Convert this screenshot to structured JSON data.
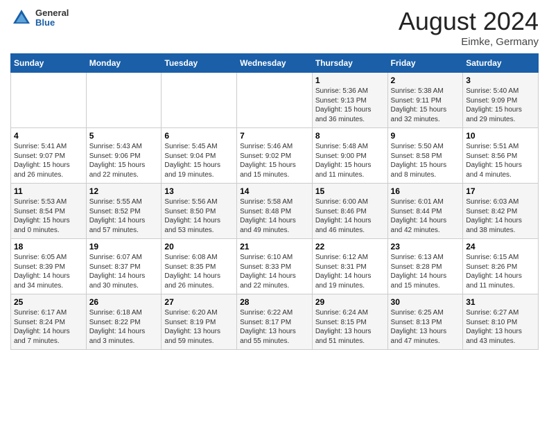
{
  "header": {
    "logo": {
      "general": "General",
      "blue": "Blue"
    },
    "title": "August 2024",
    "location": "Eimke, Germany"
  },
  "weekdays": [
    "Sunday",
    "Monday",
    "Tuesday",
    "Wednesday",
    "Thursday",
    "Friday",
    "Saturday"
  ],
  "weeks": [
    [
      {
        "day": "",
        "info": ""
      },
      {
        "day": "",
        "info": ""
      },
      {
        "day": "",
        "info": ""
      },
      {
        "day": "",
        "info": ""
      },
      {
        "day": "1",
        "info": "Sunrise: 5:36 AM\nSunset: 9:13 PM\nDaylight: 15 hours\nand 36 minutes."
      },
      {
        "day": "2",
        "info": "Sunrise: 5:38 AM\nSunset: 9:11 PM\nDaylight: 15 hours\nand 32 minutes."
      },
      {
        "day": "3",
        "info": "Sunrise: 5:40 AM\nSunset: 9:09 PM\nDaylight: 15 hours\nand 29 minutes."
      }
    ],
    [
      {
        "day": "4",
        "info": "Sunrise: 5:41 AM\nSunset: 9:07 PM\nDaylight: 15 hours\nand 26 minutes."
      },
      {
        "day": "5",
        "info": "Sunrise: 5:43 AM\nSunset: 9:06 PM\nDaylight: 15 hours\nand 22 minutes."
      },
      {
        "day": "6",
        "info": "Sunrise: 5:45 AM\nSunset: 9:04 PM\nDaylight: 15 hours\nand 19 minutes."
      },
      {
        "day": "7",
        "info": "Sunrise: 5:46 AM\nSunset: 9:02 PM\nDaylight: 15 hours\nand 15 minutes."
      },
      {
        "day": "8",
        "info": "Sunrise: 5:48 AM\nSunset: 9:00 PM\nDaylight: 15 hours\nand 11 minutes."
      },
      {
        "day": "9",
        "info": "Sunrise: 5:50 AM\nSunset: 8:58 PM\nDaylight: 15 hours\nand 8 minutes."
      },
      {
        "day": "10",
        "info": "Sunrise: 5:51 AM\nSunset: 8:56 PM\nDaylight: 15 hours\nand 4 minutes."
      }
    ],
    [
      {
        "day": "11",
        "info": "Sunrise: 5:53 AM\nSunset: 8:54 PM\nDaylight: 15 hours\nand 0 minutes."
      },
      {
        "day": "12",
        "info": "Sunrise: 5:55 AM\nSunset: 8:52 PM\nDaylight: 14 hours\nand 57 minutes."
      },
      {
        "day": "13",
        "info": "Sunrise: 5:56 AM\nSunset: 8:50 PM\nDaylight: 14 hours\nand 53 minutes."
      },
      {
        "day": "14",
        "info": "Sunrise: 5:58 AM\nSunset: 8:48 PM\nDaylight: 14 hours\nand 49 minutes."
      },
      {
        "day": "15",
        "info": "Sunrise: 6:00 AM\nSunset: 8:46 PM\nDaylight: 14 hours\nand 46 minutes."
      },
      {
        "day": "16",
        "info": "Sunrise: 6:01 AM\nSunset: 8:44 PM\nDaylight: 14 hours\nand 42 minutes."
      },
      {
        "day": "17",
        "info": "Sunrise: 6:03 AM\nSunset: 8:42 PM\nDaylight: 14 hours\nand 38 minutes."
      }
    ],
    [
      {
        "day": "18",
        "info": "Sunrise: 6:05 AM\nSunset: 8:39 PM\nDaylight: 14 hours\nand 34 minutes."
      },
      {
        "day": "19",
        "info": "Sunrise: 6:07 AM\nSunset: 8:37 PM\nDaylight: 14 hours\nand 30 minutes."
      },
      {
        "day": "20",
        "info": "Sunrise: 6:08 AM\nSunset: 8:35 PM\nDaylight: 14 hours\nand 26 minutes."
      },
      {
        "day": "21",
        "info": "Sunrise: 6:10 AM\nSunset: 8:33 PM\nDaylight: 14 hours\nand 22 minutes."
      },
      {
        "day": "22",
        "info": "Sunrise: 6:12 AM\nSunset: 8:31 PM\nDaylight: 14 hours\nand 19 minutes."
      },
      {
        "day": "23",
        "info": "Sunrise: 6:13 AM\nSunset: 8:28 PM\nDaylight: 14 hours\nand 15 minutes."
      },
      {
        "day": "24",
        "info": "Sunrise: 6:15 AM\nSunset: 8:26 PM\nDaylight: 14 hours\nand 11 minutes."
      }
    ],
    [
      {
        "day": "25",
        "info": "Sunrise: 6:17 AM\nSunset: 8:24 PM\nDaylight: 14 hours\nand 7 minutes."
      },
      {
        "day": "26",
        "info": "Sunrise: 6:18 AM\nSunset: 8:22 PM\nDaylight: 14 hours\nand 3 minutes."
      },
      {
        "day": "27",
        "info": "Sunrise: 6:20 AM\nSunset: 8:19 PM\nDaylight: 13 hours\nand 59 minutes."
      },
      {
        "day": "28",
        "info": "Sunrise: 6:22 AM\nSunset: 8:17 PM\nDaylight: 13 hours\nand 55 minutes."
      },
      {
        "day": "29",
        "info": "Sunrise: 6:24 AM\nSunset: 8:15 PM\nDaylight: 13 hours\nand 51 minutes."
      },
      {
        "day": "30",
        "info": "Sunrise: 6:25 AM\nSunset: 8:13 PM\nDaylight: 13 hours\nand 47 minutes."
      },
      {
        "day": "31",
        "info": "Sunrise: 6:27 AM\nSunset: 8:10 PM\nDaylight: 13 hours\nand 43 minutes."
      }
    ]
  ]
}
